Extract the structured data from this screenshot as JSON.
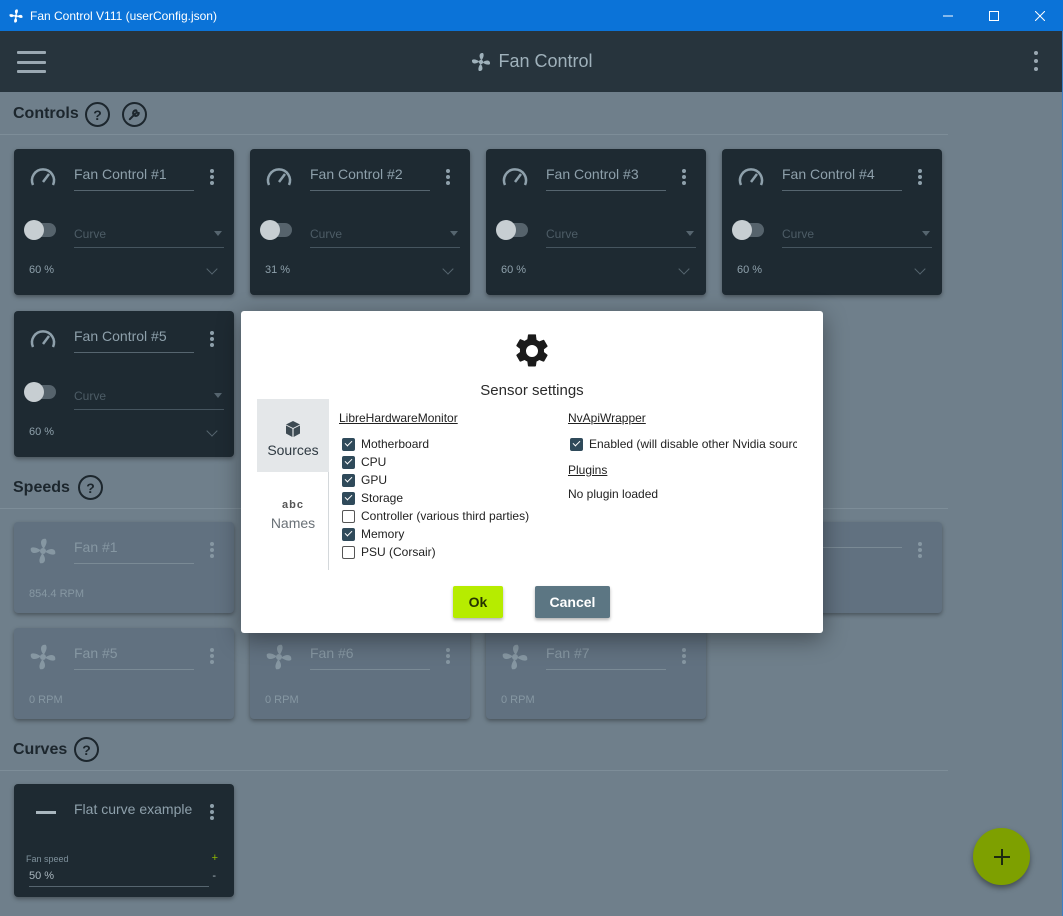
{
  "window": {
    "title": "Fan Control V111 (userConfig.json)",
    "minimize": "—",
    "maximize": "☐",
    "close": "✕"
  },
  "appbar": {
    "title": "Fan Control",
    "icon": "fan-icon"
  },
  "sections": {
    "controls": "Controls",
    "speeds": "Speeds",
    "curves": "Curves",
    "help": "?"
  },
  "controls": [
    {
      "name": "Fan Control #1",
      "curve": "Curve",
      "percent": "60 %",
      "enabled": false
    },
    {
      "name": "Fan Control #2",
      "curve": "Curve",
      "percent": "31 %",
      "enabled": false
    },
    {
      "name": "Fan Control #3",
      "curve": "Curve",
      "percent": "60 %",
      "enabled": false
    },
    {
      "name": "Fan Control #4",
      "curve": "Curve",
      "percent": "60 %",
      "enabled": false
    },
    {
      "name": "Fan Control #5",
      "curve": "Curve",
      "percent": "60 %",
      "enabled": false
    }
  ],
  "speeds": [
    {
      "name": "Fan #1",
      "rpm": "854.4 RPM"
    },
    {
      "name": "Fan #5",
      "rpm": "0 RPM"
    },
    {
      "name": "Fan #6",
      "rpm": "0 RPM"
    },
    {
      "name": "Fan #7",
      "rpm": "0 RPM"
    }
  ],
  "curves": [
    {
      "name": "Flat curve example",
      "label": "Fan speed",
      "value": "50 %",
      "plus": "+",
      "minus": "-"
    }
  ],
  "dialog": {
    "title": "Sensor settings",
    "tabs": {
      "sources": "Sources",
      "names": "Names",
      "names_icon_text": "abc"
    },
    "libre": {
      "title": "LibreHardwareMonitor",
      "items": [
        {
          "label": "Motherboard",
          "checked": true
        },
        {
          "label": "CPU",
          "checked": true
        },
        {
          "label": "GPU",
          "checked": true
        },
        {
          "label": "Storage",
          "checked": true
        },
        {
          "label": "Controller (various third parties)",
          "checked": false
        },
        {
          "label": "Memory",
          "checked": true
        },
        {
          "label": "PSU (Corsair)",
          "checked": false
        }
      ]
    },
    "nvapi": {
      "title": "NvApiWrapper",
      "enabled_label": "Enabled (will disable other Nvidia sourc",
      "enabled_checked": true
    },
    "plugins": {
      "title": "Plugins",
      "status": "No plugin loaded"
    },
    "ok": "Ok",
    "cancel": "Cancel"
  },
  "colors": {
    "accent": "#b6ec00",
    "titlebar": "#0b73d8",
    "appbar": "#27343d",
    "card_dark": "#1e2a32"
  }
}
